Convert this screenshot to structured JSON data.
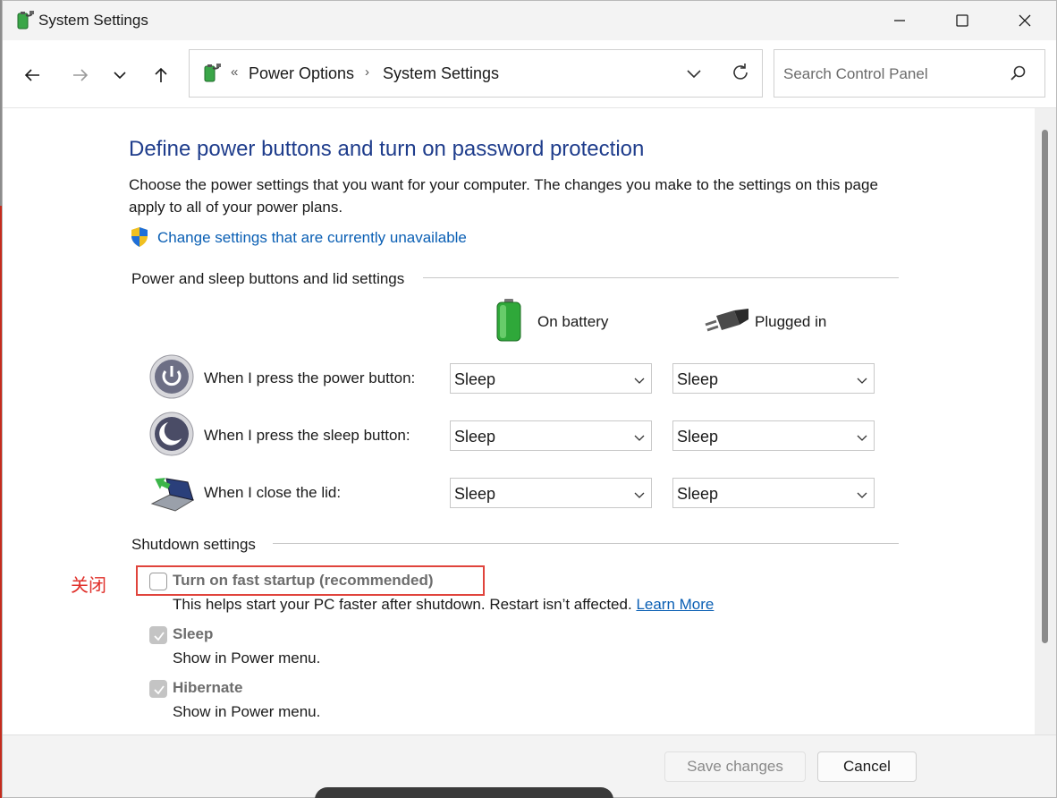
{
  "window": {
    "title": "System Settings",
    "caption_buttons": [
      "minimize",
      "maximize",
      "close"
    ]
  },
  "nav": {
    "back_icon": "back-arrow-icon",
    "forward_icon": "forward-arrow-icon",
    "recent_icon": "chevron-down-icon",
    "up_icon": "up-arrow-icon"
  },
  "address": {
    "overflow": "«",
    "crumbs": [
      "Power Options",
      "System Settings"
    ],
    "separator": "›"
  },
  "search": {
    "placeholder": "Search Control Panel",
    "value": ""
  },
  "page": {
    "heading": "Define power buttons and turn on password protection",
    "description": "Choose the power settings that you want for your computer. The changes you make to the settings on this page apply to all of your power plans.",
    "admin_link": "Change settings that are currently unavailable"
  },
  "power_section": {
    "title": "Power and sleep buttons and lid settings",
    "columns": [
      "On battery",
      "Plugged in"
    ],
    "rows": [
      {
        "label": "When I press the power button:",
        "battery": "Sleep",
        "plugged": "Sleep",
        "icon": "power-button-icon"
      },
      {
        "label": "When I press the sleep button:",
        "battery": "Sleep",
        "plugged": "Sleep",
        "icon": "sleep-button-icon"
      },
      {
        "label": "When I close the lid:",
        "battery": "Sleep",
        "plugged": "Sleep",
        "icon": "laptop-lid-icon"
      }
    ]
  },
  "shutdown_section": {
    "title": "Shutdown settings",
    "annotation": "关闭",
    "items": [
      {
        "label": "Turn on fast startup (recommended)",
        "sub": "This helps start your PC faster after shutdown. Restart isn’t affected.",
        "link": "Learn More",
        "checked": false
      },
      {
        "label": "Sleep",
        "sub": "Show in Power menu.",
        "checked": true
      },
      {
        "label": "Hibernate",
        "sub": "Show in Power menu.",
        "checked": true
      }
    ]
  },
  "footer": {
    "save": "Save changes",
    "cancel": "Cancel"
  },
  "colors": {
    "heading": "#1f3d8c",
    "link": "#0a5fb4",
    "annotation": "#e0302a"
  }
}
